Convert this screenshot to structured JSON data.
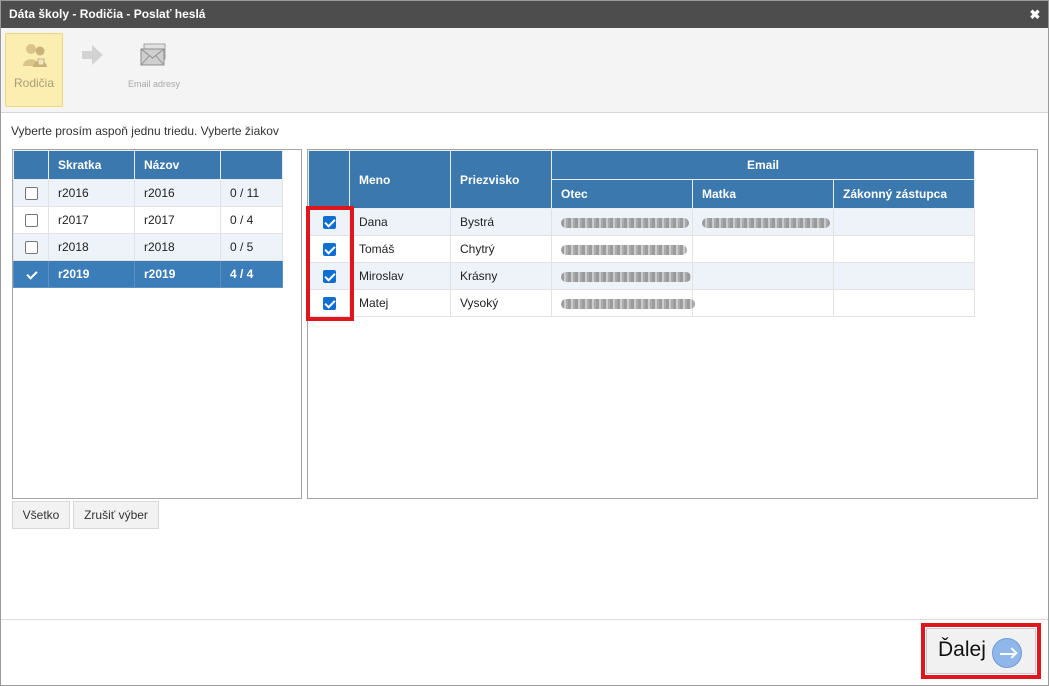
{
  "window": {
    "title": "Dáta školy - Rodičia - Poslať heslá",
    "close_icon": "close-icon"
  },
  "wizard": {
    "steps": [
      {
        "label": "Rodičia",
        "icon": "parents-icon",
        "active": true
      },
      {
        "label": "Email adresy",
        "icon": "envelope-icon",
        "active": false
      }
    ],
    "arrow_icon": "arrow-right-icon"
  },
  "instruction": "Vyberte prosím aspoň jednu triedu. Vyberte žiakov",
  "classes": {
    "columns": [
      "Skratka",
      "Názov",
      ""
    ],
    "rows": [
      {
        "checked": false,
        "short": "r2016",
        "name": "r2016",
        "count": "0 / 11"
      },
      {
        "checked": false,
        "short": "r2017",
        "name": "r2017",
        "count": "0 / 4"
      },
      {
        "checked": false,
        "short": "r2018",
        "name": "r2018",
        "count": "0 / 5"
      },
      {
        "checked": true,
        "short": "r2019",
        "name": "r2019",
        "count": "4 / 4"
      }
    ]
  },
  "students": {
    "columns": {
      "first": "Meno",
      "last": "Priezvisko",
      "email_group": "Email",
      "father": "Otec",
      "mother": "Matka",
      "guardian": "Zákonný zástupca"
    },
    "rows": [
      {
        "checked": true,
        "first": "Dana",
        "last": "Bystrá"
      },
      {
        "checked": true,
        "first": "Tomáš",
        "last": "Chytrý"
      },
      {
        "checked": true,
        "first": "Miroslav",
        "last": "Krásny"
      },
      {
        "checked": true,
        "first": "Matej",
        "last": "Vysoký"
      }
    ]
  },
  "buttons": {
    "select_all": "Všetko",
    "clear_selection": "Zrušiť výber",
    "next": "Ďalej"
  },
  "colors": {
    "header_blue": "#3a78ad",
    "selected_row": "#3a7db8",
    "highlight_red": "#e0161f",
    "title_bar": "#4d4d4d"
  }
}
